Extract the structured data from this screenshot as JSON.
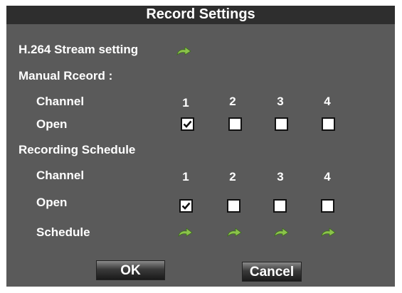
{
  "window": {
    "title": "Record Settings"
  },
  "stream": {
    "label": "H.264 Stream setting",
    "icon": "green-arrow-icon"
  },
  "manual": {
    "heading": "Manual Rceord :",
    "channel_label": "Channel",
    "open_label": "Open",
    "channels": [
      "1",
      "2",
      "3",
      "4"
    ],
    "open_checked": [
      true,
      false,
      false,
      false
    ]
  },
  "schedule": {
    "heading_part1": "Recording",
    "heading_part2": "Schedule",
    "channel_label": "Channel",
    "open_label": "Open",
    "schedule_label": "Schedule",
    "channels": [
      "1",
      "2",
      "3",
      "4"
    ],
    "open_checked": [
      true,
      false,
      false,
      false
    ]
  },
  "buttons": {
    "ok": "OK",
    "cancel": "Cancel"
  },
  "colors": {
    "panel": "#5a5a5a",
    "titlebar": "#2e2e2e",
    "arrow": "#8bc34a"
  }
}
